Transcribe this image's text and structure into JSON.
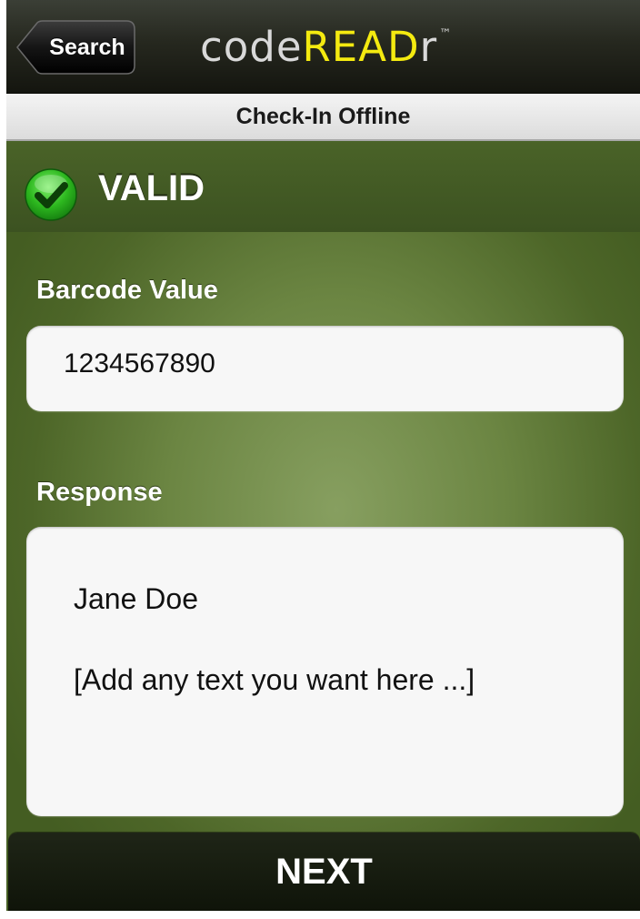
{
  "navbar": {
    "back_label": "Search",
    "logo": {
      "part1": "code",
      "part2": "READ",
      "part3": "r",
      "trademark": "™"
    }
  },
  "subheader": {
    "title": "Check-In Offline"
  },
  "status": {
    "icon": "check-circle-icon",
    "text": "VALID",
    "color": "#2db81f"
  },
  "barcode": {
    "label": "Barcode Value",
    "value": "1234567890"
  },
  "response": {
    "label": "Response",
    "name": "Jane Doe",
    "note": "[Add any text you want here ...]"
  },
  "next_button": {
    "label": "NEXT"
  },
  "colors": {
    "background": "#6b8542",
    "logo_accent": "#f4ea10",
    "navbar": "#1c1e16"
  }
}
